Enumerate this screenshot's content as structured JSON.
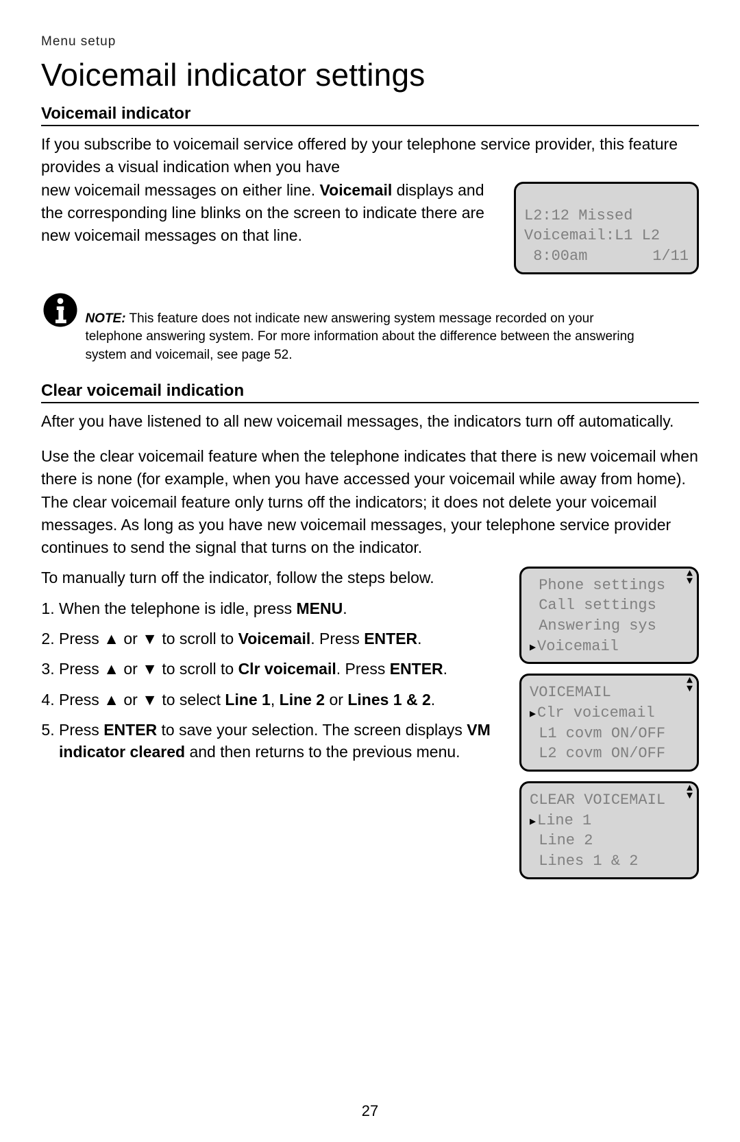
{
  "breadcrumb": "Menu setup",
  "title": "Voicemail indicator settings",
  "section1": {
    "heading": "Voicemail indicator",
    "para_full": "If you subscribe to voicemail service offered by your telephone service provider, this feature provides a visual indication when you have",
    "para_tail": "new voicemail messages on either line. ",
    "para_bold1": "Voicemail",
    "para_tail2": " displays and the corresponding line blinks on the screen to indicate there are new voicemail messages on that line."
  },
  "lcd_idle": {
    "line1": "L2:12 Missed",
    "line2": "Voicemail:L1 L2",
    "line3_left": " 8:00am",
    "line3_right": "1/11"
  },
  "note": {
    "label": "NOTE:",
    "text": " This feature does not indicate new answering system message recorded on your telephone answering system. For more information about the difference between the answering system and voicemail, see page 52."
  },
  "section2": {
    "heading": "Clear voicemail indication",
    "p1": "After you have listened to all new voicemail messages, the indicators turn off automatically.",
    "p2": "Use the clear voicemail feature when the telephone indicates that there is new voicemail when there is none (for example, when you have accessed your voicemail while away from home). The clear voicemail feature only turns off the indicators; it does not delete your voicemail messages. As long as you have new voicemail messages, your telephone service provider continues to send the signal that turns on the indicator.",
    "lead": "To manually turn off the indicator, follow the steps below."
  },
  "steps": {
    "s1a": "When the telephone is idle, press ",
    "s1b": "MENU",
    "s1c": ".",
    "s2a": "Press ",
    "s2b": " or ",
    "s2c": " to scroll to ",
    "s2d": "Voicemail",
    "s2e": ". Press ",
    "s2f": "ENTER",
    "s2g": ".",
    "s3a": "Press ",
    "s3b": " or ",
    "s3c": " to scroll to ",
    "s3d": "Clr voicemail",
    "s3e": ". Press ",
    "s3f": "ENTER",
    "s3g": ".",
    "s4a": "Press ",
    "s4b": " or ",
    "s4c": " to select ",
    "s4d": "Line 1",
    "s4e": ", ",
    "s4f": "Line 2",
    "s4g": " or ",
    "s4h": "Lines 1 & 2",
    "s4i": ".",
    "s5a": "Press ",
    "s5b": "ENTER",
    "s5c": " to save your selection. The screen displays ",
    "s5d": "VM indicator cleared",
    "s5e": " and then returns to the previous menu."
  },
  "lcd_menu": {
    "l1": " Phone settings",
    "l2": " Call settings",
    "l3": " Answering sys",
    "l4": "Voicemail"
  },
  "lcd_vm": {
    "l1": "VOICEMAIL",
    "l2": "Clr voicemail",
    "l3": " L1 covm ON/OFF",
    "l4": " L2 covm ON/OFF"
  },
  "lcd_clear": {
    "l1": "CLEAR VOICEMAIL",
    "l2": "Line 1",
    "l3": " Line 2",
    "l4": " Lines 1 & 2"
  },
  "glyphs": {
    "up": "▲",
    "down": "▼"
  },
  "pagenum": "27"
}
